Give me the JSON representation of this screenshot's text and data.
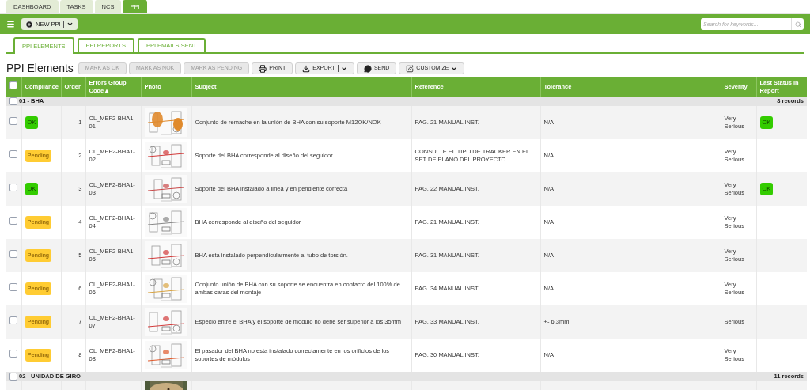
{
  "top_tabs": [
    {
      "label": "DASHBOARD",
      "selected": false
    },
    {
      "label": "TASKS",
      "selected": false
    },
    {
      "label": "NCS",
      "selected": false
    },
    {
      "label": "PPI",
      "selected": true
    }
  ],
  "toolbar": {
    "new_button": "NEW PPI",
    "search": {
      "placeholder": "Search for keywords..."
    }
  },
  "sub_tabs": [
    {
      "label": "PPI ELEMENTS",
      "selected": true
    },
    {
      "label": "PPI REPORTS",
      "selected": false
    },
    {
      "label": "PPI EMAILS SENT",
      "selected": false
    }
  ],
  "page_title": "PPI Elements",
  "actions": [
    {
      "label": "MARK AS OK",
      "kind": "text",
      "disabled": true
    },
    {
      "label": "MARK AS NOK",
      "kind": "text",
      "disabled": true
    },
    {
      "label": "MARK AS PENDING",
      "kind": "text",
      "disabled": true
    },
    {
      "label": "PRINT",
      "kind": "print",
      "disabled": false
    },
    {
      "label": "EXPORT",
      "kind": "export",
      "disabled": false
    },
    {
      "label": "SEND",
      "kind": "send",
      "disabled": false
    },
    {
      "label": "CUSTOMIZE",
      "kind": "customize",
      "disabled": false
    }
  ],
  "table": {
    "select_all": {
      "checked": false
    },
    "columns": [
      {
        "label": "Compliance"
      },
      {
        "label": "Order"
      },
      {
        "label": "Errors Group Code",
        "sort_indicator": "▴"
      },
      {
        "label": "Photo"
      },
      {
        "label": "Subject"
      },
      {
        "label": "Reference"
      },
      {
        "label": "Tolerance"
      },
      {
        "label": "Severity"
      },
      {
        "label": "Last Status in Report"
      }
    ],
    "groups": [
      {
        "name": "01 - BHA",
        "count": "8 records",
        "checked": false,
        "rows": [
          {
            "checked": false,
            "compliance": {
              "label": "OK",
              "kind": "ok"
            },
            "order": "1",
            "code": "CL_MEF2-BHA1-01",
            "subject": "Conjunto de remache en la unión de BHA con su soporte M12OK/NOK",
            "reference": "PAG. 21 MANUAL INST.",
            "tolerance": "N/A",
            "severity": "Very Serious",
            "last_status": {
              "label": "OK",
              "kind": "ok"
            }
          },
          {
            "checked": false,
            "compliance": {
              "label": "Pending",
              "kind": "pending"
            },
            "order": "2",
            "code": "CL_MEF2-BHA1-02",
            "subject": "Soporte del BHA corresponde al diseño del seguidor",
            "reference": "CONSULTE EL TIPO DE TRACKER EN EL SET DE PLANO DEL PROYECTO",
            "tolerance": "N/A",
            "severity": "Very Serious"
          },
          {
            "checked": false,
            "compliance": {
              "label": "OK",
              "kind": "ok"
            },
            "order": "3",
            "code": "CL_MEF2-BHA1-03",
            "subject": "Soporte del BHA instalado a línea y en pendiente correcta",
            "reference": "PAG. 22 MANUAL INST.",
            "tolerance": "N/A",
            "severity": "Very Serious",
            "last_status": {
              "label": "OK",
              "kind": "ok"
            }
          },
          {
            "checked": false,
            "compliance": {
              "label": "Pending",
              "kind": "pending"
            },
            "order": "4",
            "code": "CL_MEF2-BHA1-04",
            "subject": "BHA corresponde al diseño del seguidor",
            "reference": "PAG. 21 MANUAL INST.",
            "tolerance": "N/A",
            "severity": "Very Serious"
          },
          {
            "checked": false,
            "compliance": {
              "label": "Pending",
              "kind": "pending"
            },
            "order": "5",
            "code": "CL_MEF2-BHA1-05",
            "subject": "BHA esta instalado perpendicularmente al tubo de torsión.",
            "reference": "PAG. 31 MANUAL INST.",
            "tolerance": "N/A",
            "severity": "Very Serious"
          },
          {
            "checked": false,
            "compliance": {
              "label": "Pending",
              "kind": "pending"
            },
            "order": "6",
            "code": "CL_MEF2-BHA1-06",
            "subject": "Conjunto unión de BHA con su soporte se encuentra en contacto del 100% de ambas caras del montaje",
            "reference": "PAG. 34 MANUAL INST.",
            "tolerance": "N/A",
            "severity": "Very Serious"
          },
          {
            "checked": false,
            "compliance": {
              "label": "Pending",
              "kind": "pending"
            },
            "order": "7",
            "code": "CL_MEF2-BHA1-07",
            "subject": "Especio entre el BHA y el soporte de modulo no debe ser superior a los 35mm",
            "reference": "PAG. 33 MANUAL INST.",
            "tolerance": "+- 6,3mm",
            "severity": "Serious"
          },
          {
            "checked": false,
            "compliance": {
              "label": "Pending",
              "kind": "pending"
            },
            "order": "8",
            "code": "CL_MEF2-BHA1-08",
            "subject": "El pasador del BHA no esta instalado correctamente en los orificios de los soportes de módulos",
            "reference": "PAG. 30 MANUAL INST.",
            "tolerance": "N/A",
            "severity": "Very Serious"
          }
        ]
      },
      {
        "name": "02 - UNIDAD DE GIRO",
        "count": "11 records",
        "checked": false
      }
    ]
  }
}
